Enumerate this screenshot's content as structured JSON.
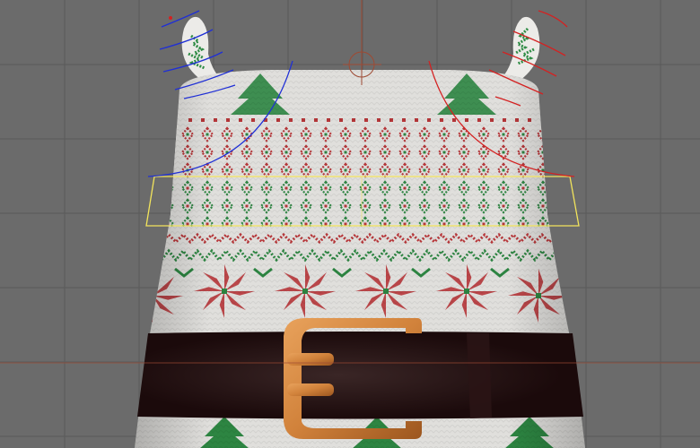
{
  "viewport": {
    "background": "#6b6b6b",
    "grid_color": "#5a5a5a",
    "grid_step": 83
  },
  "colors": {
    "knit_base": "#ecebe8",
    "knit_shadow": "#cfcfcf",
    "knit_red": "#c0393c",
    "knit_green": "#2f8c45",
    "belt": "#1b0a0b",
    "belt_highlight": "#3a2626",
    "buckle": "#d1823b",
    "buckle_dark": "#9c561f",
    "rig_left": "#1f2fd6",
    "rig_right": "#d42121",
    "selection": "#f2e45c",
    "origin": "#9e4a33"
  },
  "icons": {
    "left_ear_rig": "blue-rotate-handles-icon",
    "right_ear_rig": "red-rotate-handles-icon",
    "pivot": "origin-target-icon"
  }
}
